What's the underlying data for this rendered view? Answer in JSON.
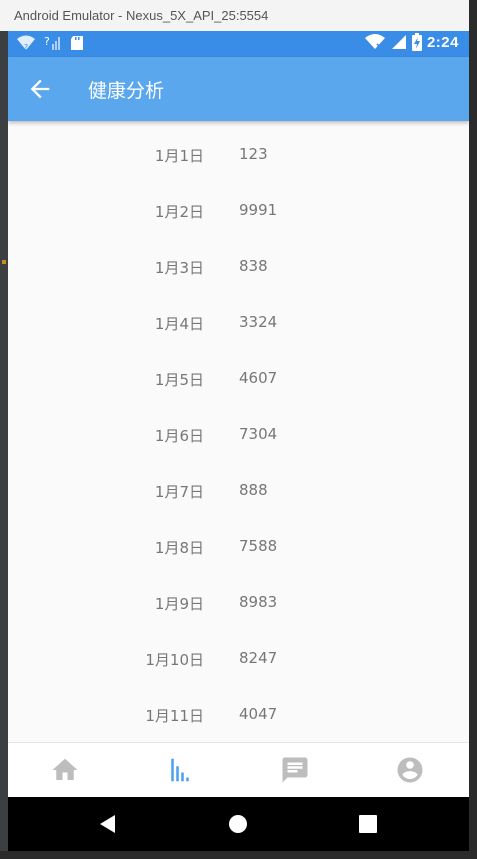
{
  "window": {
    "title": "Android Emulator - Nexus_5X_API_25:5554"
  },
  "statusbar": {
    "time": "2:24",
    "icons": [
      "wifi-question-icon",
      "signal-question-icon",
      "sd-card-icon",
      "wifi-x-icon",
      "signal-icon",
      "battery-charging-icon"
    ]
  },
  "appbar": {
    "title": "健康分析",
    "back_icon": "arrow-back-icon"
  },
  "list": {
    "rows": [
      {
        "date": "1月1日",
        "value": "123"
      },
      {
        "date": "1月2日",
        "value": "9991"
      },
      {
        "date": "1月3日",
        "value": "838"
      },
      {
        "date": "1月4日",
        "value": "3324"
      },
      {
        "date": "1月5日",
        "value": "4607"
      },
      {
        "date": "1月6日",
        "value": "7304"
      },
      {
        "date": "1月7日",
        "value": "888"
      },
      {
        "date": "1月8日",
        "value": "7588"
      },
      {
        "date": "1月9日",
        "value": "8983"
      },
      {
        "date": "1月10日",
        "value": "8247"
      },
      {
        "date": "1月11日",
        "value": "4047"
      }
    ]
  },
  "bottom_nav": {
    "items": [
      {
        "icon": "home-icon",
        "active": false
      },
      {
        "icon": "chart-bars-icon",
        "active": true
      },
      {
        "icon": "message-icon",
        "active": false
      },
      {
        "icon": "account-circle-icon",
        "active": false
      }
    ],
    "active_color": "#4a9ff0",
    "inactive_color": "#bdbdbd"
  },
  "colors": {
    "statusbar": "#3a8de6",
    "appbar": "#5aa7ee",
    "text": "#777777"
  }
}
